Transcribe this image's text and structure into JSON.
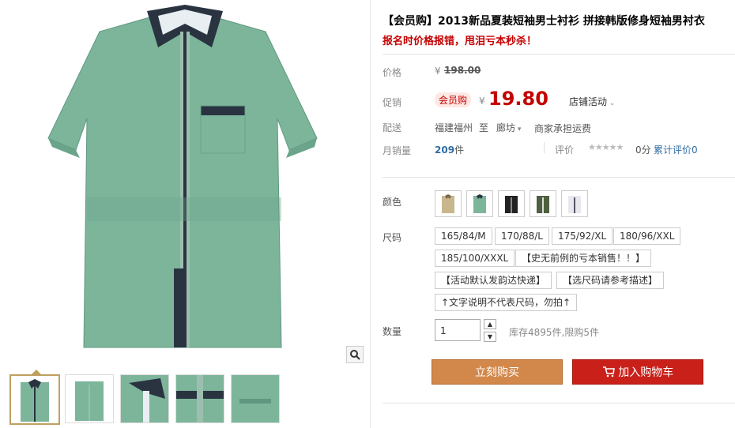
{
  "product": {
    "title": "【会员购】2013新品夏装短袖男士衬衫 拼接韩版修身短袖男衬衣",
    "subtitle": "报名时价格报错，甩泪亏本秒杀！",
    "colors": {
      "shirt": "#7db59b",
      "collar": "#2a3340",
      "accent": "#c40000"
    }
  },
  "price": {
    "label": "价格",
    "currency": "¥",
    "original": "198.00"
  },
  "promo": {
    "label": "促销",
    "badge": "会员购",
    "currency": "¥",
    "price": "19.80",
    "store_activity": "店铺活动"
  },
  "shipping": {
    "label": "配送",
    "from": "福建福州",
    "to_word": "至",
    "destination": "廊坊",
    "fee_note": "商家承担运费"
  },
  "sales": {
    "label": "月销量",
    "count": "209",
    "unit": "件",
    "rating_label": "评价",
    "stars": "★★★★★",
    "score": "0分",
    "reviews": "累计评价0"
  },
  "colors": {
    "label": "颜色",
    "swatches": [
      {
        "name": "swatch-khaki",
        "color": "#c8b78c"
      },
      {
        "name": "swatch-green",
        "color": "#7db59b"
      },
      {
        "name": "swatch-black",
        "color": "#222222"
      },
      {
        "name": "swatch-army",
        "color": "#4f6040"
      },
      {
        "name": "swatch-white",
        "color": "#e8e8ee"
      }
    ]
  },
  "sizes": {
    "label": "尺码",
    "options": [
      "165/84/M",
      "170/88/L",
      "175/92/XL",
      "180/96/XXL",
      "185/100/XXXL",
      "【史无前例的亏本销售！！】",
      "【活动默认发韵达快递】",
      "【选尺码请参考描述】",
      "↑文字说明不代表尺码，勿拍↑"
    ]
  },
  "quantity": {
    "label": "数量",
    "value": "1",
    "stock": "库存4895件,限购5件"
  },
  "buttons": {
    "buy_now": "立刻购买",
    "add_to_cart": "加入购物车"
  }
}
